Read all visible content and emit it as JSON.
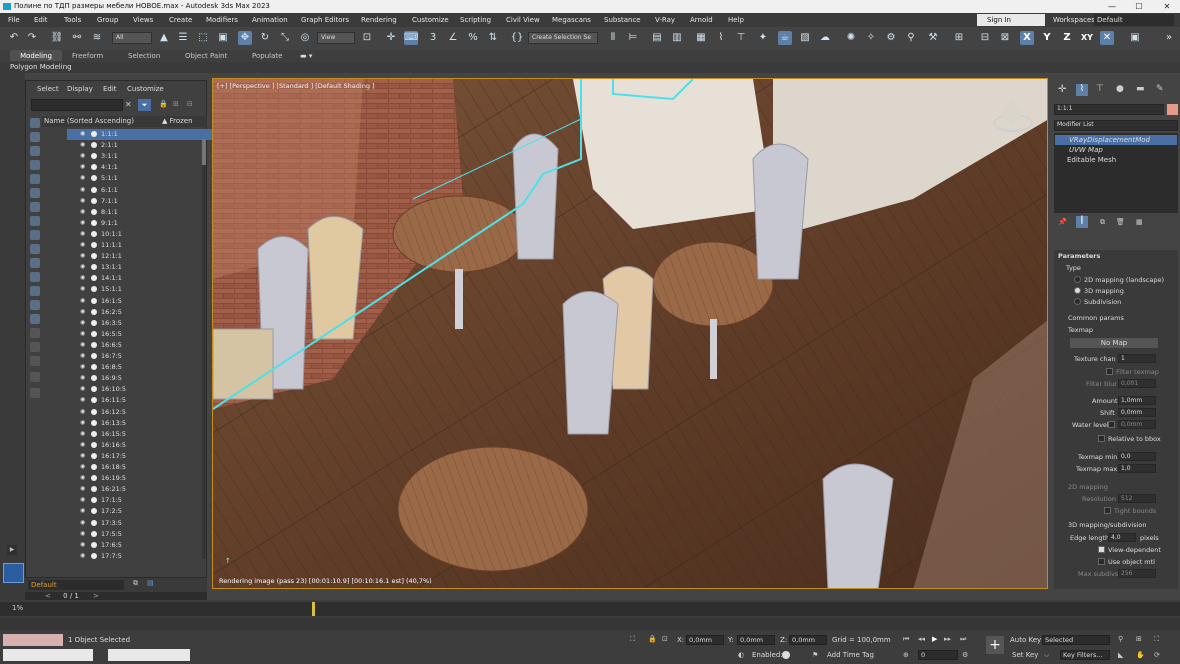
{
  "titlebar": {
    "title": "Полине по ТДП размеры мебели НОВОЕ.max - Autodesk 3ds Max 2023",
    "minimize": "—",
    "maximize": "☐",
    "close": "✕"
  },
  "menu": [
    "File",
    "Edit",
    "Tools",
    "Group",
    "Views",
    "Create",
    "Modifiers",
    "Animation",
    "Graph Editors",
    "Rendering",
    "Customize",
    "Scripting",
    "Civil View",
    "Megascans",
    "Substance",
    "V-Ray",
    "Arnold",
    "Help"
  ],
  "signin": "Sign In",
  "workspaces_label": "Workspaces:",
  "workspace_value": "Default",
  "toolbar": {
    "filter_all": "All",
    "view_dropdown": "View",
    "selection_set": "Create Selection Se",
    "axis_x": "X",
    "axis_y": "Y",
    "axis_z": "Z",
    "axis_xy": "XY"
  },
  "ribbon_tabs": [
    "Modeling",
    "Freeform",
    "Selection",
    "Object Paint",
    "Populate"
  ],
  "ribbon_sub": "Polygon Modeling",
  "scene_explorer": {
    "menu": [
      "Select",
      "Display",
      "Edit",
      "Customize"
    ],
    "col_name": "Name (Sorted Ascending)",
    "col_frozen": "▲ Frozen",
    "rows": [
      "1:1:1",
      "2:1:1",
      "3:1:1",
      "4:1:1",
      "5:1:1",
      "6:1:1",
      "7:1:1",
      "8:1:1",
      "9:1:1",
      "10:1:1",
      "11:1:1",
      "12:1:1",
      "13:1:1",
      "14:1:1",
      "15:1:1",
      "16:1:5",
      "16:2:5",
      "16:3:5",
      "16:5:5",
      "16:6:5",
      "16:7:5",
      "16:8:5",
      "16:9:5",
      "16:10:5",
      "16:11:5",
      "16:12:5",
      "16:13:5",
      "16:15:5",
      "16:16:5",
      "16:17:5",
      "16:18:5",
      "16:19:5",
      "16:21:5",
      "17:1:5",
      "17:2:5",
      "17:3:5",
      "17:5:5",
      "17:6:5",
      "17:7:5"
    ],
    "layer": "Default",
    "frame_counter": "0 / 1"
  },
  "viewport": {
    "label": "[+] [Perspective ] [Standard ] [Default Shading ]",
    "render_status": "Rendering image (pass 23) [00:01:10.9] [00:10:16.1 est]   (40,7%)"
  },
  "command_panel": {
    "object_name": "1:1:1",
    "modifier_list": "Modifier List",
    "stack": [
      "VRayDisplacementMod",
      "UVW Map",
      "Editable Mesh"
    ],
    "params_title": "Parameters",
    "type_label": "Type",
    "type_options": [
      "2D mapping (landscape)",
      "3D mapping",
      "Subdivision"
    ],
    "common_params": "Common params",
    "texmap": "Texmap",
    "no_map": "No Map",
    "texture_chan_label": "Texture chan",
    "texture_chan": "1",
    "filter_texmap": "Filter texmap",
    "filter_blur_label": "Filter blur",
    "filter_blur": "0,001",
    "amount_label": "Amount",
    "amount": "1,0mm",
    "shift_label": "Shift",
    "shift": "0,0mm",
    "water_label": "Water level",
    "water": "0,0mm",
    "relative": "Relative to bbox",
    "texmap_min_label": "Texmap min",
    "texmap_min": "0,0",
    "texmap_max_label": "Texmap max",
    "texmap_max": "1,0",
    "mapping2d": "2D mapping",
    "resolution_label": "Resolution",
    "resolution": "512",
    "tight": "Tight bounds",
    "mapping3d": "3D mapping/subdivision",
    "edge_label": "Edge length",
    "edge": "4,0",
    "pixels": "pixels",
    "view_dep": "View-dependent",
    "use_obj": "Use object mtl",
    "max_subdivs_label": "Max subdivs",
    "max_subdivs": "256"
  },
  "timeline": {
    "marker": "1%"
  },
  "status": {
    "selected": "1 Object Selected",
    "x_label": "X:",
    "x": "0,0mm",
    "y_label": "Y:",
    "y": "0,0mm",
    "z_label": "Z:",
    "z": "0,0mm",
    "grid": "Grid = 100,0mm",
    "enabled": "Enabled:",
    "add_time_tag": "Add Time Tag",
    "auto_key": "Auto Key",
    "selected_dd": "Selected",
    "set_key": "Set Key",
    "key_filters": "Key Filters...",
    "frame": "0"
  },
  "colors": {
    "accent": "#6b9ed6",
    "selection": "#4a6fa5",
    "viewport_border": "#c48c1a"
  }
}
